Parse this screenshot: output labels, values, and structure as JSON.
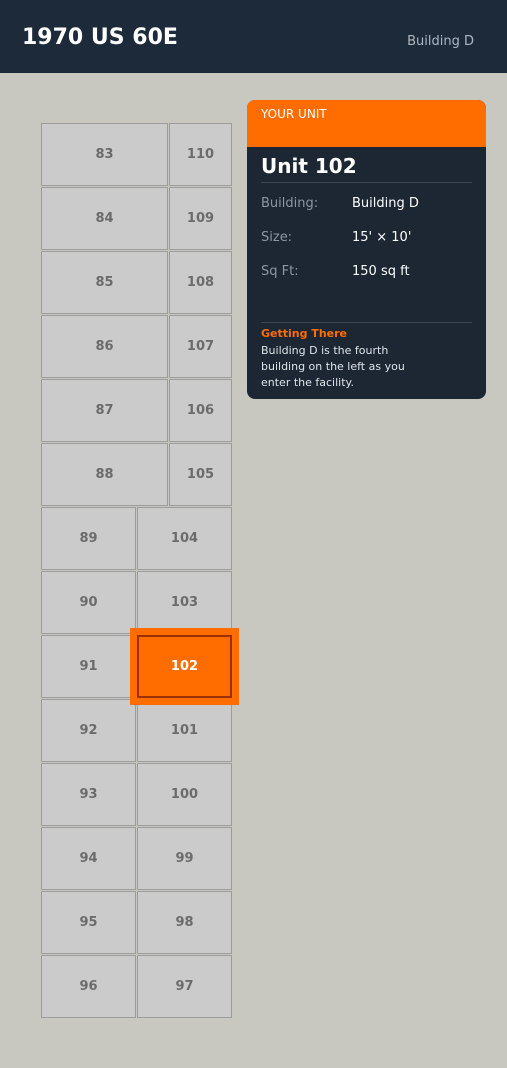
{
  "header": {
    "title": "1970 US 60E",
    "building": "Building D"
  },
  "map": {
    "selected_unit": "102",
    "left_column_wide": [
      "83",
      "84",
      "85",
      "86",
      "87",
      "88"
    ],
    "right_column_narrow": [
      "110",
      "109",
      "108",
      "107",
      "106",
      "105"
    ],
    "left_column_lower": [
      "89",
      "90",
      "91",
      "92",
      "93",
      "94",
      "95",
      "96"
    ],
    "right_column_lower": [
      "104",
      "103",
      "102",
      "101",
      "100",
      "99",
      "98",
      "97"
    ]
  },
  "card": {
    "tag": "YOUR UNIT",
    "title": "Unit 102",
    "rows": [
      {
        "label": "Building:",
        "value": "Building D"
      },
      {
        "label": "Size:",
        "value": "15' × 10'"
      },
      {
        "label": "Sq Ft:",
        "value": "150 sq ft"
      }
    ],
    "directions_heading": "Getting There",
    "directions_text": "Building D is the fourth building on the left as you enter the facility."
  },
  "colors": {
    "accent": "#ff6c00",
    "header_bg": "#1c2a3a",
    "card_bg": "#1c2733",
    "unit_bg": "#cbcbcb",
    "page_bg": "#c8c8c0"
  }
}
